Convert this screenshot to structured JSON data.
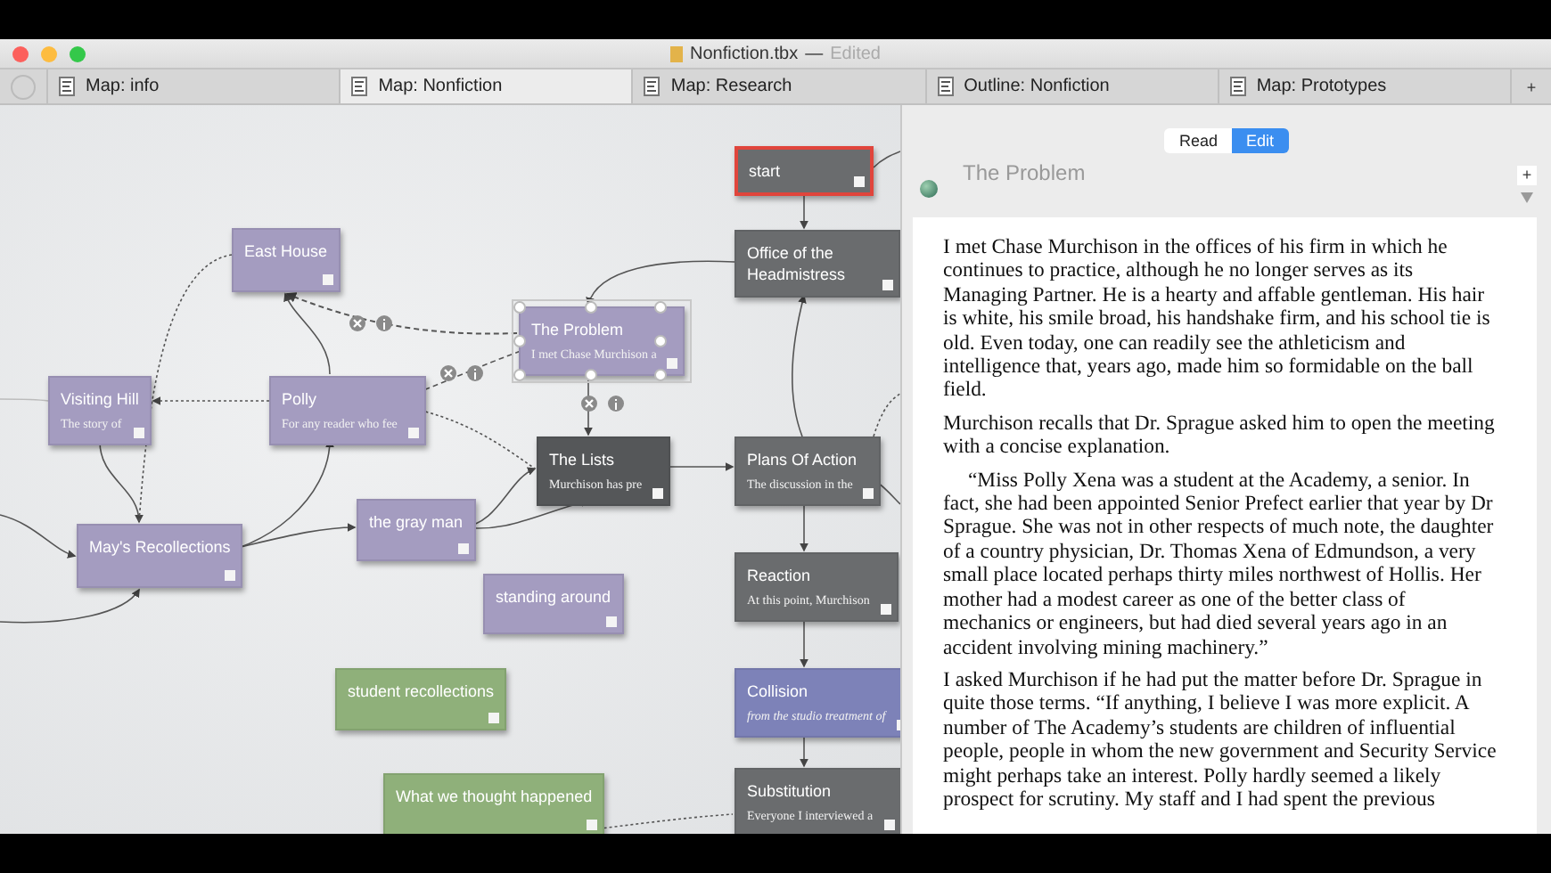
{
  "window": {
    "title": "Nonfiction.tbx",
    "separator": "—",
    "status": "Edited"
  },
  "tabs": [
    {
      "label": "Map: info",
      "selected": false
    },
    {
      "label": "Map: Nonfiction",
      "selected": true
    },
    {
      "label": "Map: Research",
      "selected": false
    },
    {
      "label": "Outline: Nonfiction",
      "selected": false
    },
    {
      "label": "Map: Prototypes",
      "selected": false
    }
  ],
  "new_tab": "+",
  "map": {
    "nodes": [
      {
        "title": "East House",
        "kind": "note",
        "color": "#a49cc0",
        "selected": false
      },
      {
        "title": "Visiting Hill",
        "subtitle": "The story of",
        "kind": "note",
        "color": "#a49cc0",
        "selected": false
      },
      {
        "title": "Polly",
        "subtitle": "For any reader who fee",
        "kind": "note",
        "color": "#a49cc0",
        "selected": false
      },
      {
        "title": "May's Recollections",
        "kind": "note",
        "color": "#a49cc0",
        "selected": false
      },
      {
        "title": "the gray man",
        "kind": "note",
        "color": "#a49cc0",
        "selected": false
      },
      {
        "title": "The Problem",
        "subtitle": "I met Chase Murchison a",
        "kind": "note",
        "color": "#a49cc0",
        "selected": true
      },
      {
        "title": "The Lists",
        "subtitle": "Murchison has pre",
        "kind": "note",
        "color": "#555759",
        "selected": false
      },
      {
        "title": "standing around",
        "kind": "note",
        "color": "#a49cc0",
        "selected": false
      },
      {
        "title": "student recollections",
        "kind": "note",
        "color": "#8fb07a",
        "selected": false
      },
      {
        "title": "What we thought happened",
        "kind": "note",
        "color": "#8fb07a",
        "selected": false
      },
      {
        "title": "start",
        "kind": "start",
        "color": "#6a6c6e",
        "selected": false
      },
      {
        "title": "Office of the Headmistress",
        "kind": "note",
        "color": "#6a6c6e",
        "selected": false
      },
      {
        "title": "Plans Of Action",
        "subtitle": "The discussion in the",
        "kind": "note",
        "color": "#6a6c6e",
        "selected": false
      },
      {
        "title": "Reaction",
        "subtitle": "At this point, Murchison",
        "kind": "note",
        "color": "#6a6c6e",
        "selected": false
      },
      {
        "title": "Collision",
        "subtitle": "from the studio treatment of",
        "kind": "note",
        "color": "#7d82b8",
        "selected": false
      },
      {
        "title": "Substitution",
        "subtitle": "Everyone I interviewed a",
        "kind": "note",
        "color": "#6a6c6e",
        "selected": false
      }
    ]
  },
  "editor": {
    "modes": [
      {
        "label": "Read",
        "selected": false
      },
      {
        "label": "Edit",
        "selected": true
      }
    ],
    "note_title": "The Problem",
    "add": "+",
    "paragraphs": [
      {
        "text": "I met Chase Murchison in the offices of his firm in which he continues to practice, although he no longer serves as its Managing Partner.  He is a hearty and affable gentleman. His hair is white, his smile broad, his handshake firm, and his school tie is old. Even today, one can readily see the athleticism and intelligence that, years ago, made him so formidable on the ball field.",
        "indent": false
      },
      {
        "text": "Murchison recalls that Dr. Sprague asked him to open the meeting with a concise explanation.",
        "indent": false
      },
      {
        "text": "“Miss Polly Xena was a student at the Academy, a senior.  In fact, she had been appointed Senior Prefect earlier that year by Dr Sprague. She was not in other respects of much note, the daughter of a country physician, Dr. Thomas Xena of Edmundson, a very small place located perhaps thirty miles northwest of Hollis.  Her mother had a modest career as one of the better class of mechanics or engineers, but had died several years ago in an accident involving mining machinery.”",
        "indent": true
      },
      {
        "text": "I asked Murchison if he had put the matter before Dr. Sprague in quite those terms. “If anything, I believe I was more explicit. A number of The Academy’s students are children of influential people,  people in whom the new government and Security Service might perhaps take an interest. Polly hardly seemed a likely prospect for scrutiny. My staff and I had spent the previous",
        "indent": false
      }
    ]
  }
}
